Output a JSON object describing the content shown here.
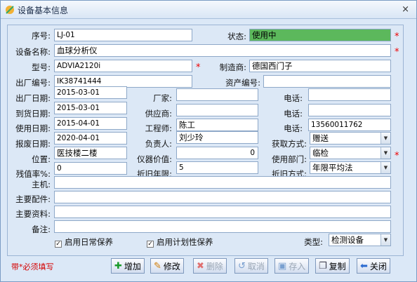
{
  "window": {
    "title": "设备基本信息",
    "close": "×"
  },
  "labels": {
    "serial": "序号:",
    "status": "状态:",
    "name": "设备名称:",
    "model": "型号:",
    "manufacturer": "制造商:",
    "factory_no": "出厂编号:",
    "asset_no": "资产编号:",
    "factory_date": "出厂日期:",
    "vendor": "厂家:",
    "vendor_phone": "电话:",
    "arrival_date": "到货日期:",
    "supplier": "供应商:",
    "supplier_phone": "电话:",
    "use_date": "使用日期:",
    "engineer": "工程师:",
    "engineer_phone": "电话:",
    "scrap_date": "报废日期:",
    "person": "负责人:",
    "acquire": "获取方式:",
    "location": "位置:",
    "value": "仪器价值:",
    "dept": "使用部门:",
    "residual": "残值率%:",
    "dep_years": "折旧年限:",
    "dep_method": "折旧方式:",
    "host": "主机:",
    "parts": "主要配件:",
    "docs": "主要资料:",
    "remark": "备注:",
    "type": "类型:"
  },
  "fields": {
    "serial": "LJ-01",
    "status": "使用中",
    "name": "血球分析仪",
    "model": "ADVIA2120i",
    "manufacturer": "德国西门子",
    "factory_no": "IK38741444",
    "asset_no": "",
    "factory_date": "2015-03-01",
    "vendor": "",
    "vendor_phone": "",
    "arrival_date": "2015-03-01",
    "supplier": "",
    "supplier_phone": "",
    "use_date": "2015-04-01",
    "engineer": "陈工",
    "engineer_phone": "13560011762",
    "scrap_date": "2020-04-01",
    "person": "刘少玲",
    "acquire": "赠送",
    "location": "医技楼二楼",
    "value": "0",
    "dept": "临检",
    "residual": "0",
    "dep_years": "5",
    "dep_method": "年限平均法",
    "host": "",
    "parts": "",
    "docs": "",
    "remark": "",
    "type": "检测设备"
  },
  "checks": {
    "daily": "启用日常保养",
    "planned": "启用计划性保养",
    "checkmark": "✓"
  },
  "required_mark": "*",
  "note": "带*必须填写",
  "toolbar": {
    "add": "增加",
    "edit": "修改",
    "delete": "删除",
    "cancel": "取消",
    "save": "存入",
    "copy": "复制",
    "close": "关闭"
  },
  "icons": {
    "title": "app-icon",
    "add": "plus-icon",
    "edit": "pencil-icon",
    "delete": "x-icon",
    "cancel": "undo-icon",
    "save": "disk-icon",
    "copy": "copy-icon",
    "close": "arrow-left-icon"
  },
  "colors": {
    "status_bg": "#5cb85c",
    "required": "#e00000",
    "panel": "#dce8f6"
  }
}
